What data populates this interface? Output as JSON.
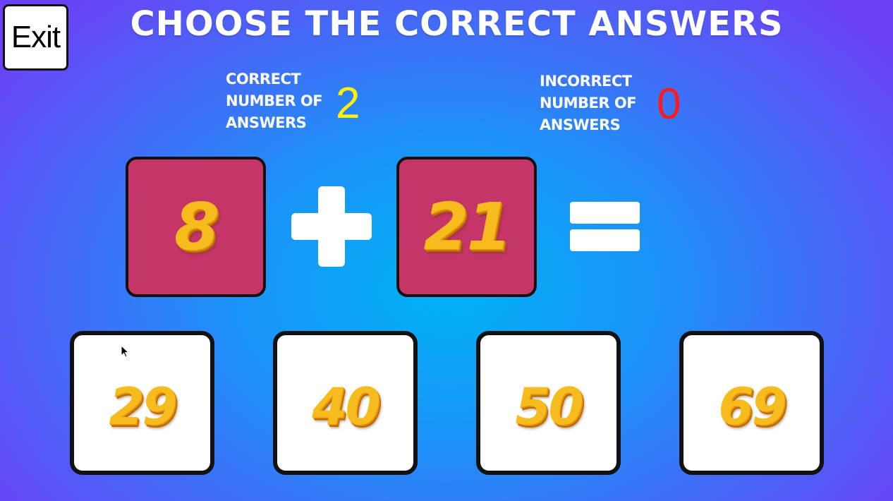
{
  "exit_label": "Exit",
  "title": "CHOOSE THE CORRECT ANSWERS",
  "correct": {
    "label_lines": [
      "CORRECT",
      "NUMBER OF",
      "ANSWERS"
    ],
    "value": "2",
    "color": "#fff200"
  },
  "incorrect": {
    "label_lines": [
      "INCORRECT",
      "NUMBER OF",
      "ANSWERS"
    ],
    "value": "0",
    "color": "#ff1a1a"
  },
  "equation": {
    "left_operand": "8",
    "operator": "plus-icon",
    "right_operand": "21",
    "equals": "equals-icon"
  },
  "answers": [
    "29",
    "40",
    "50",
    "69"
  ],
  "colors": {
    "operand_tile": "#c63567",
    "answer_tile": "#ffffff",
    "number_gold": "#f6bc1d"
  }
}
